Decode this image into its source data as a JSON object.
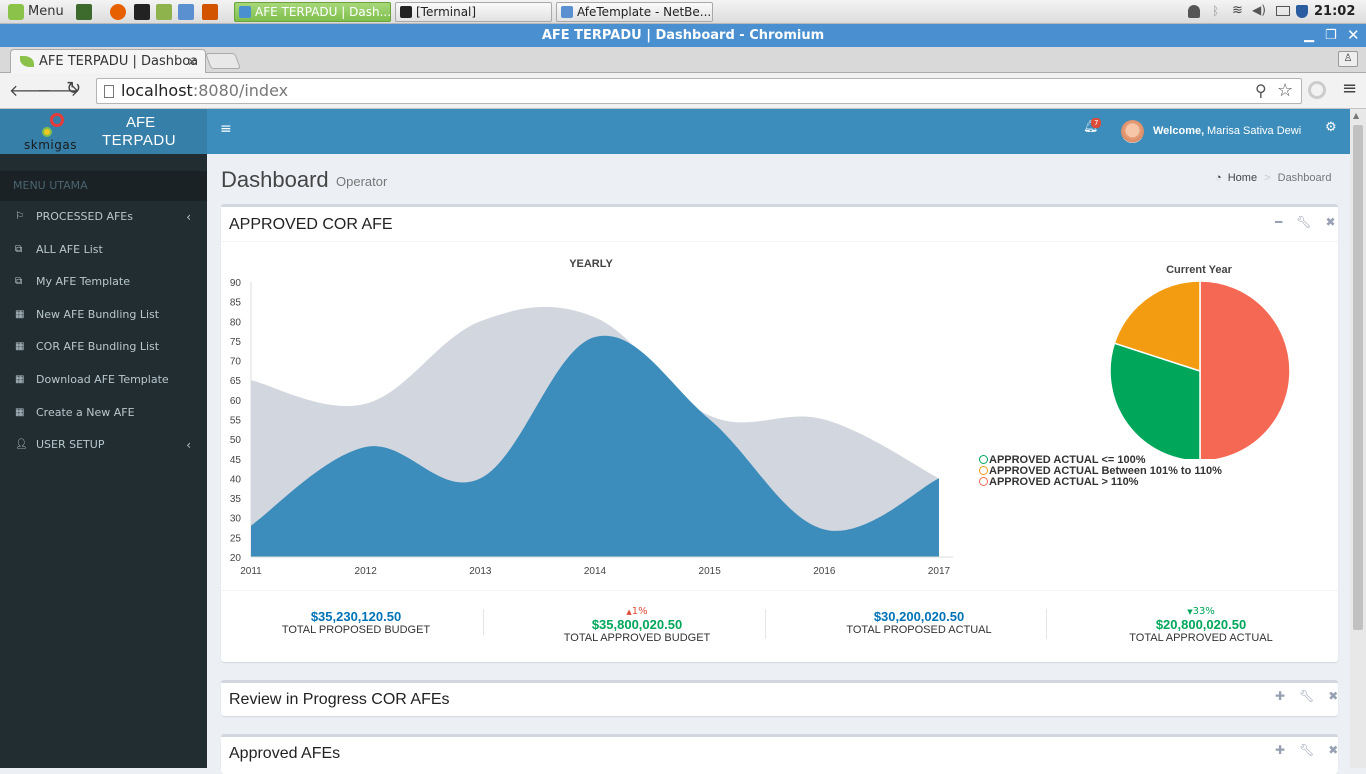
{
  "taskbar": {
    "menu_label": "Menu",
    "windows": [
      {
        "label": "AFE TERPADU | Dash..."
      },
      {
        "label": "[Terminal]"
      },
      {
        "label": "AfeTemplate - NetBe..."
      }
    ],
    "clock": "21:02"
  },
  "browser": {
    "window_title": "AFE TERPADU | Dashboard - Chromium",
    "tab_title": "AFE TERPADU | Dashboa",
    "url_host": "localhost",
    "url_rest": ":8080/index"
  },
  "app": {
    "brand_line1": "AFE",
    "brand_line2": "TERPADU",
    "logo_text": "skmigas",
    "notification_count": "7",
    "welcome_label": "Welcome,",
    "user_name": "Marisa Sativa Dewi"
  },
  "sidebar": {
    "header": "MENU UTAMA",
    "items": [
      {
        "label": "PROCESSED AFEs",
        "icon": "flag-icon"
      },
      {
        "label": "ALL AFE List",
        "icon": "copy-icon"
      },
      {
        "label": "My AFE Template",
        "icon": "copy-icon"
      },
      {
        "label": "New AFE Bundling List",
        "icon": "grid-icon"
      },
      {
        "label": "COR AFE Bundling List",
        "icon": "grid-icon"
      },
      {
        "label": "Download AFE Template",
        "icon": "grid-icon"
      },
      {
        "label": "Create a New AFE",
        "icon": "grid-icon"
      },
      {
        "label": "USER SETUP",
        "icon": "user-icon"
      }
    ]
  },
  "page": {
    "title": "Dashboard",
    "subtitle": "Operator",
    "breadcrumb_home": "Home",
    "breadcrumb_current": "Dashboard"
  },
  "boxes": {
    "approved_cor": {
      "title": "APPROVED COR AFE"
    },
    "review": {
      "title": "Review in Progress COR AFEs"
    },
    "approved": {
      "title": "Approved AFEs"
    }
  },
  "kpis": [
    {
      "value": "$35,230,120.50",
      "label": "TOTAL PROPOSED BUDGET",
      "change": "",
      "color": "#0073b7"
    },
    {
      "value": "$35,800,020.50",
      "label": "TOTAL APPROVED BUDGET",
      "change": "1%",
      "direction": "up",
      "color": "#00a65a"
    },
    {
      "value": "$30,200,020.50",
      "label": "TOTAL PROPOSED ACTUAL",
      "change": "",
      "color": "#0073b7"
    },
    {
      "value": "$20,800,020.50",
      "label": "TOTAL APPROVED ACTUAL",
      "change": "33%",
      "direction": "down",
      "color": "#00a65a"
    }
  ],
  "chart_data": [
    {
      "type": "area",
      "title": "YEARLY",
      "x": [
        "2011",
        "2012",
        "2013",
        "2014",
        "2015",
        "2016",
        "2017"
      ],
      "series": [
        {
          "values": [
            65,
            59,
            80,
            81,
            56,
            55,
            40
          ],
          "color": "#d2d6de"
        },
        {
          "values": [
            28,
            48,
            40,
            76,
            55,
            27,
            40
          ],
          "color": "#3c8dbc"
        }
      ],
      "ylim": [
        20,
        90
      ],
      "yticks": [
        20,
        25,
        30,
        35,
        40,
        45,
        50,
        55,
        60,
        65,
        70,
        75,
        80,
        85,
        90
      ]
    },
    {
      "type": "pie",
      "title": "Current Year",
      "slices": [
        {
          "name": "APPROVED ACTUAL > 110%",
          "value": 50,
          "color": "#f56954"
        },
        {
          "name": "APPROVED ACTUAL <= 100%",
          "value": 30,
          "color": "#00a65a"
        },
        {
          "name": "APPROVED ACTUAL Between 101% to 110%",
          "value": 20,
          "color": "#f39c12"
        }
      ],
      "legend": [
        {
          "label": "APPROVED ACTUAL <= 100%",
          "color": "#00a65a"
        },
        {
          "label": "APPROVED ACTUAL Between 101% to 110%",
          "color": "#f39c12"
        },
        {
          "label": "APPROVED ACTUAL > 110%",
          "color": "#f56954"
        }
      ]
    }
  ]
}
